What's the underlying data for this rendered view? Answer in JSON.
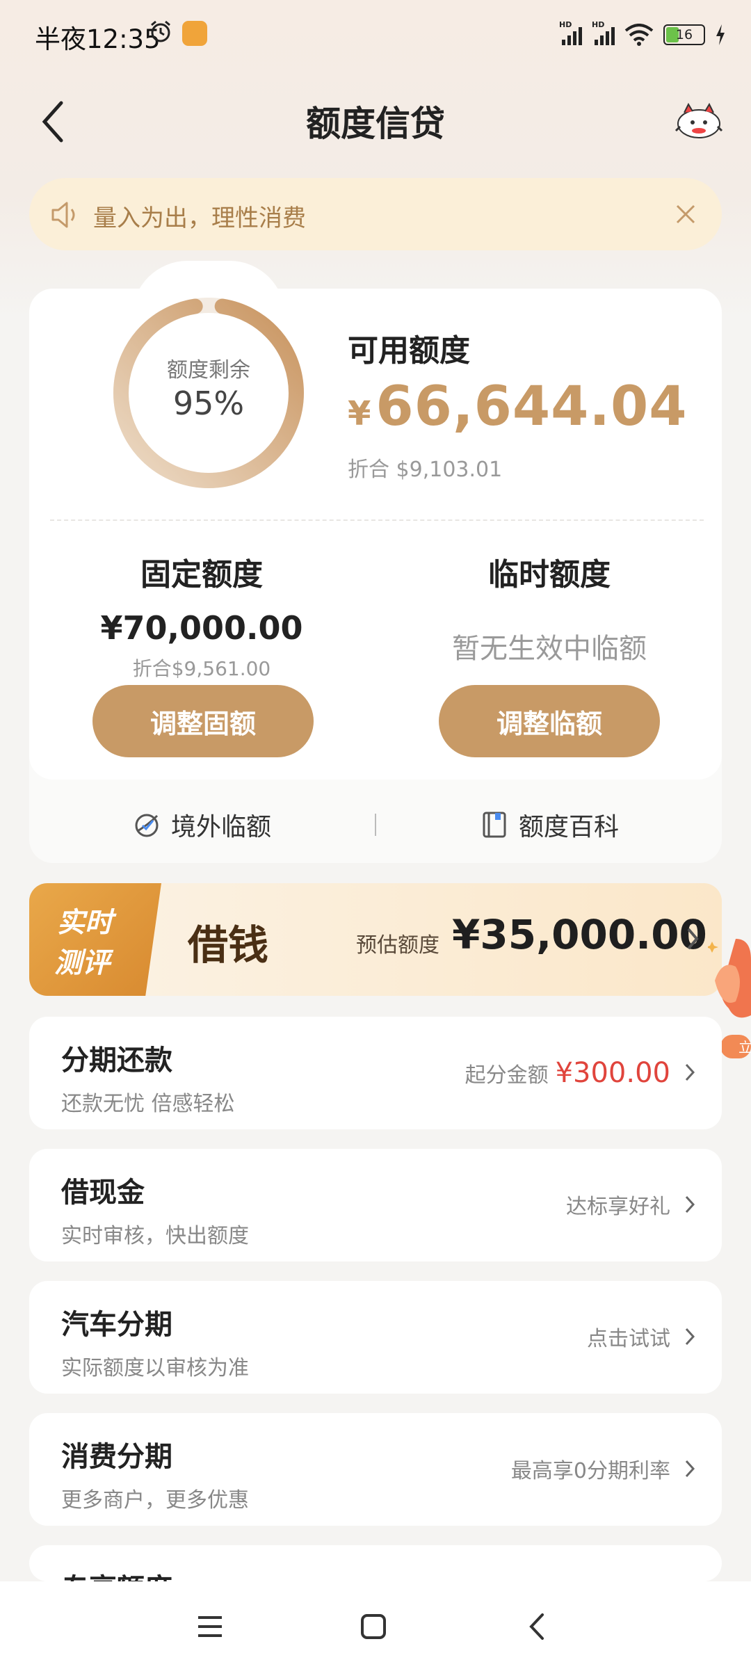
{
  "status_bar": {
    "time": "半夜12:35",
    "signal1": "HD",
    "signal2": "HD",
    "battery": "16"
  },
  "header": {
    "title": "额度信贷"
  },
  "notice": {
    "text": "量入为出，理性消费"
  },
  "quota": {
    "ring_label": "额度剩余",
    "ring_percent": "95%",
    "ring_fraction": 0.95,
    "available_label": "可用额度",
    "currency": "¥",
    "available_amount": "66,644.04",
    "available_converted": "折合  $9,103.01",
    "fixed": {
      "title": "固定额度",
      "amount": "¥70,000.00",
      "converted": "折合$9,561.00",
      "button": "调整固额"
    },
    "temp": {
      "title": "临时额度",
      "empty_text": "暂无生效中临额",
      "button": "调整临额"
    },
    "links": [
      {
        "label": "境外临额",
        "icon": "overseas-quota-icon"
      },
      {
        "label": "额度百科",
        "icon": "encyclopedia-book-icon"
      }
    ]
  },
  "borrow_banner": {
    "tag_line1": "实时",
    "tag_line2": "测评",
    "title": "借钱",
    "estimate_label": "预估额度",
    "estimate_amount": "¥35,000.00",
    "float_badge": "立"
  },
  "list_items": [
    {
      "title": "分期还款",
      "subtitle": "还款无忧 倍感轻松",
      "right_text": "起分金额",
      "right_value": "¥300.00"
    },
    {
      "title": "借现金",
      "subtitle": "实时审核，快出额度",
      "right_text": "达标享好礼"
    },
    {
      "title": "汽车分期",
      "subtitle": "实际额度以审核为准",
      "right_text": "点击试试"
    },
    {
      "title": "消费分期",
      "subtitle": "更多商户，更多优惠",
      "right_text": "最高享0分期利率"
    },
    {
      "title": "专享额度",
      "subtitle": ""
    }
  ],
  "colors": {
    "accent": "#c89a66",
    "brown_text": "#a87e4a",
    "red": "#e0443c",
    "notice_bg": "#fbefd8",
    "page_bg": "#f5f4f2"
  },
  "nav": {
    "icons": [
      "menu-icon",
      "home-square-icon",
      "back-triangle-icon"
    ]
  }
}
